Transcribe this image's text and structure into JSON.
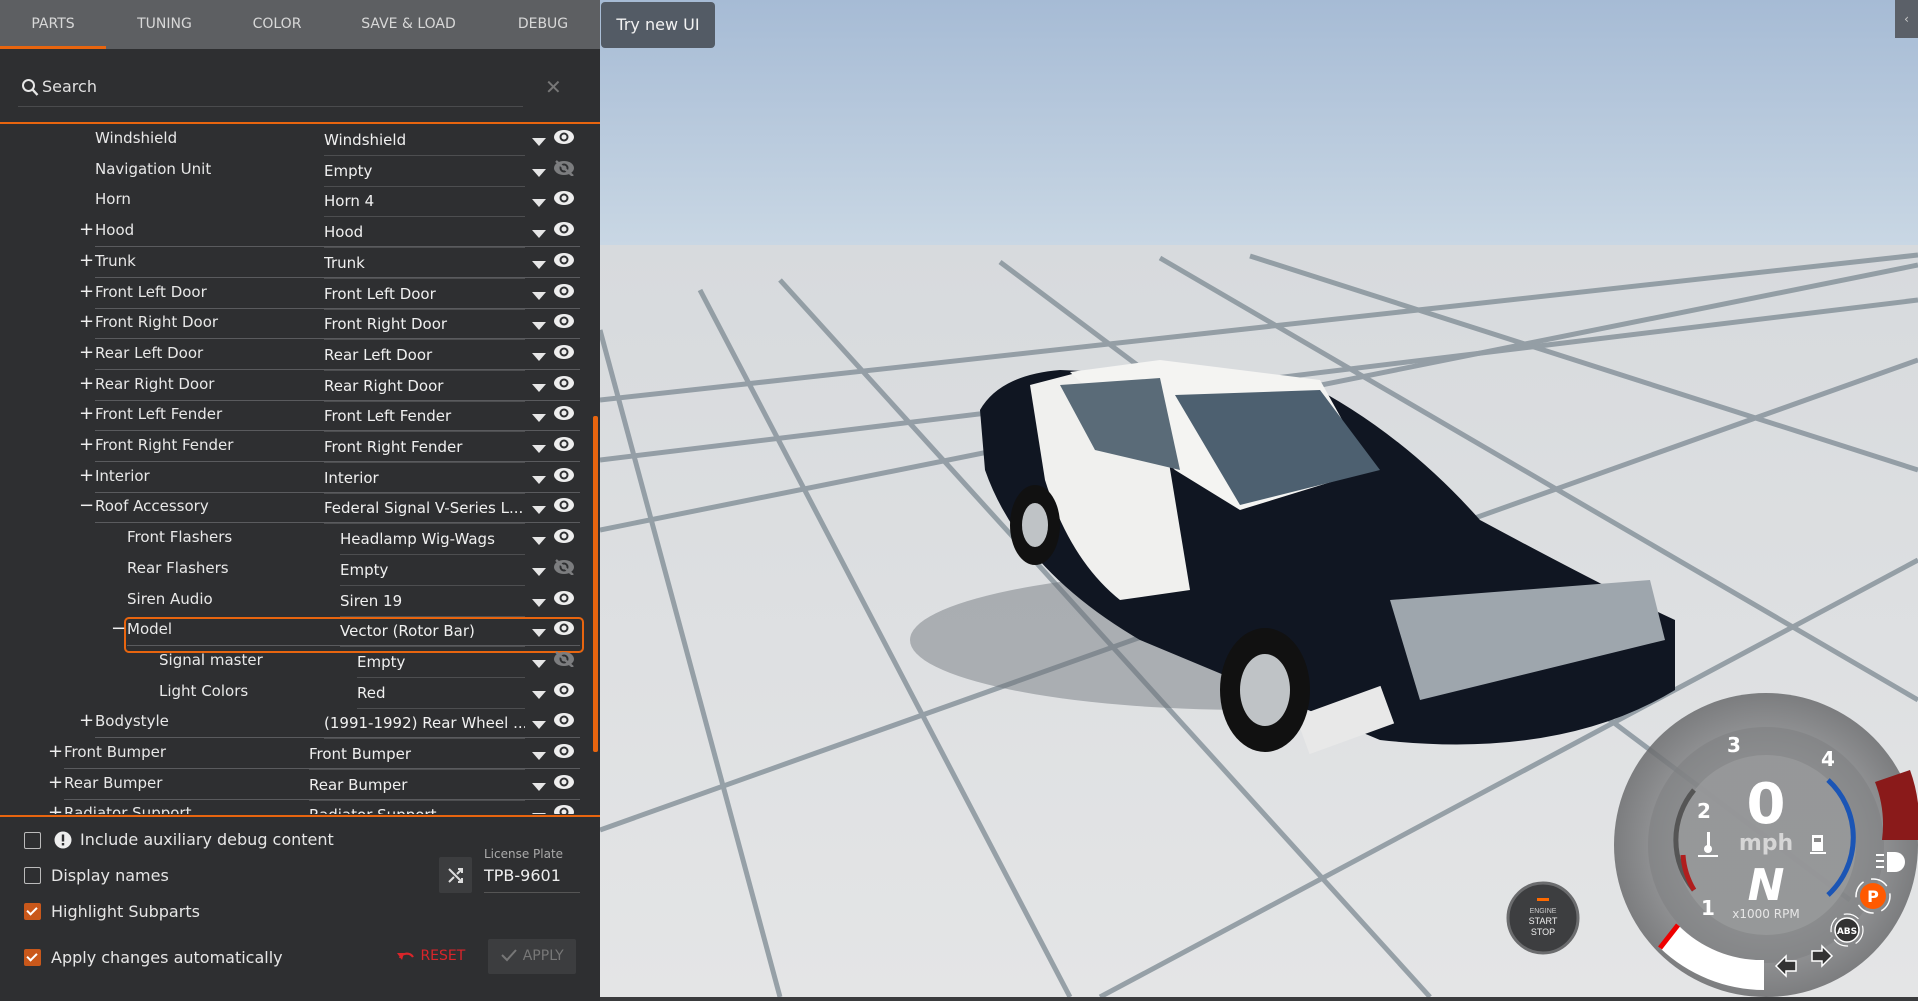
{
  "tabs": [
    {
      "label": "PARTS",
      "active": true
    },
    {
      "label": "TUNING"
    },
    {
      "label": "COLOR"
    },
    {
      "label": "SAVE & LOAD"
    },
    {
      "label": "DEBUG"
    }
  ],
  "search": {
    "placeholder": "Search",
    "clear_icon": "close-icon"
  },
  "parts": [
    {
      "level": 1,
      "expand": "",
      "label": "Windshield",
      "value": "Windshield",
      "visible": true
    },
    {
      "level": 1,
      "expand": "",
      "label": "Navigation Unit",
      "value": "Empty",
      "visible": false
    },
    {
      "level": 1,
      "expand": "",
      "label": "Horn",
      "value": "Horn 4",
      "visible": true
    },
    {
      "level": 1,
      "expand": "+",
      "label": "Hood",
      "value": "Hood",
      "visible": true
    },
    {
      "level": 1,
      "expand": "+",
      "label": "Trunk",
      "value": "Trunk",
      "visible": true
    },
    {
      "level": 1,
      "expand": "+",
      "label": "Front Left Door",
      "value": "Front Left Door",
      "visible": true
    },
    {
      "level": 1,
      "expand": "+",
      "label": "Front Right Door",
      "value": "Front Right Door",
      "visible": true
    },
    {
      "level": 1,
      "expand": "+",
      "label": "Rear Left Door",
      "value": "Rear Left Door",
      "visible": true
    },
    {
      "level": 1,
      "expand": "+",
      "label": "Rear Right Door",
      "value": "Rear Right Door",
      "visible": true
    },
    {
      "level": 1,
      "expand": "+",
      "label": "Front Left Fender",
      "value": "Front Left Fender",
      "visible": true
    },
    {
      "level": 1,
      "expand": "+",
      "label": "Front Right Fender",
      "value": "Front Right Fender",
      "visible": true
    },
    {
      "level": 1,
      "expand": "+",
      "label": "Interior",
      "value": "Interior",
      "visible": true
    },
    {
      "level": 1,
      "expand": "−",
      "label": "Roof Accessory",
      "value": "Federal Signal V-Series L...",
      "visible": true
    },
    {
      "level": 2,
      "expand": "",
      "label": "Front Flashers",
      "value": "Headlamp Wig-Wags",
      "visible": true
    },
    {
      "level": 2,
      "expand": "",
      "label": "Rear Flashers",
      "value": "Empty",
      "visible": false
    },
    {
      "level": 2,
      "expand": "",
      "label": "Siren Audio",
      "value": "Siren 19",
      "visible": true
    },
    {
      "level": 2,
      "expand": "−",
      "label": "Model",
      "value": "Vector (Rotor Bar)",
      "visible": true,
      "highlighted": true
    },
    {
      "level": 3,
      "expand": "",
      "label": "Signal master",
      "value": "Empty",
      "visible": false
    },
    {
      "level": 3,
      "expand": "",
      "label": "Light Colors",
      "value": "Red",
      "visible": true
    },
    {
      "level": 1,
      "expand": "+",
      "label": "Bodystyle",
      "value": "(1991-1992) Rear Wheel ...",
      "visible": true
    },
    {
      "level": 0,
      "expand": "+",
      "label": "Front Bumper",
      "value": "Front Bumper",
      "visible": true
    },
    {
      "level": 0,
      "expand": "+",
      "label": "Rear Bumper",
      "value": "Rear Bumper",
      "visible": true
    },
    {
      "level": 0,
      "expand": "+",
      "label": "Radiator Support",
      "value": "Radiator Support",
      "visible": true
    }
  ],
  "options": {
    "aux_debug": {
      "label": "Include auxiliary debug content",
      "checked": false
    },
    "display_names": {
      "label": "Display names",
      "checked": false
    },
    "highlight_subparts": {
      "label": "Highlight Subparts",
      "checked": true
    },
    "apply_auto": {
      "label": "Apply changes automatically",
      "checked": true
    }
  },
  "license_plate": {
    "label": "License Plate",
    "value": "TPB-9601"
  },
  "buttons": {
    "reset": "RESET",
    "apply": "APPLY",
    "try_new_ui": "Try new UI",
    "collapse": "‹"
  },
  "dashboard": {
    "speed": "0",
    "speed_unit": "mph",
    "gear": "N",
    "rpm_label": "x1000 RPM",
    "rpm_ticks": [
      "1",
      "2",
      "3",
      "4"
    ],
    "engine_button": {
      "line1": "ENGINE",
      "line2": "START",
      "line3": "STOP"
    },
    "abs": "ABS",
    "parking": "P"
  },
  "colors": {
    "accent": "#e8650f",
    "reset": "#d9252a",
    "parking": "#ff5a00"
  }
}
